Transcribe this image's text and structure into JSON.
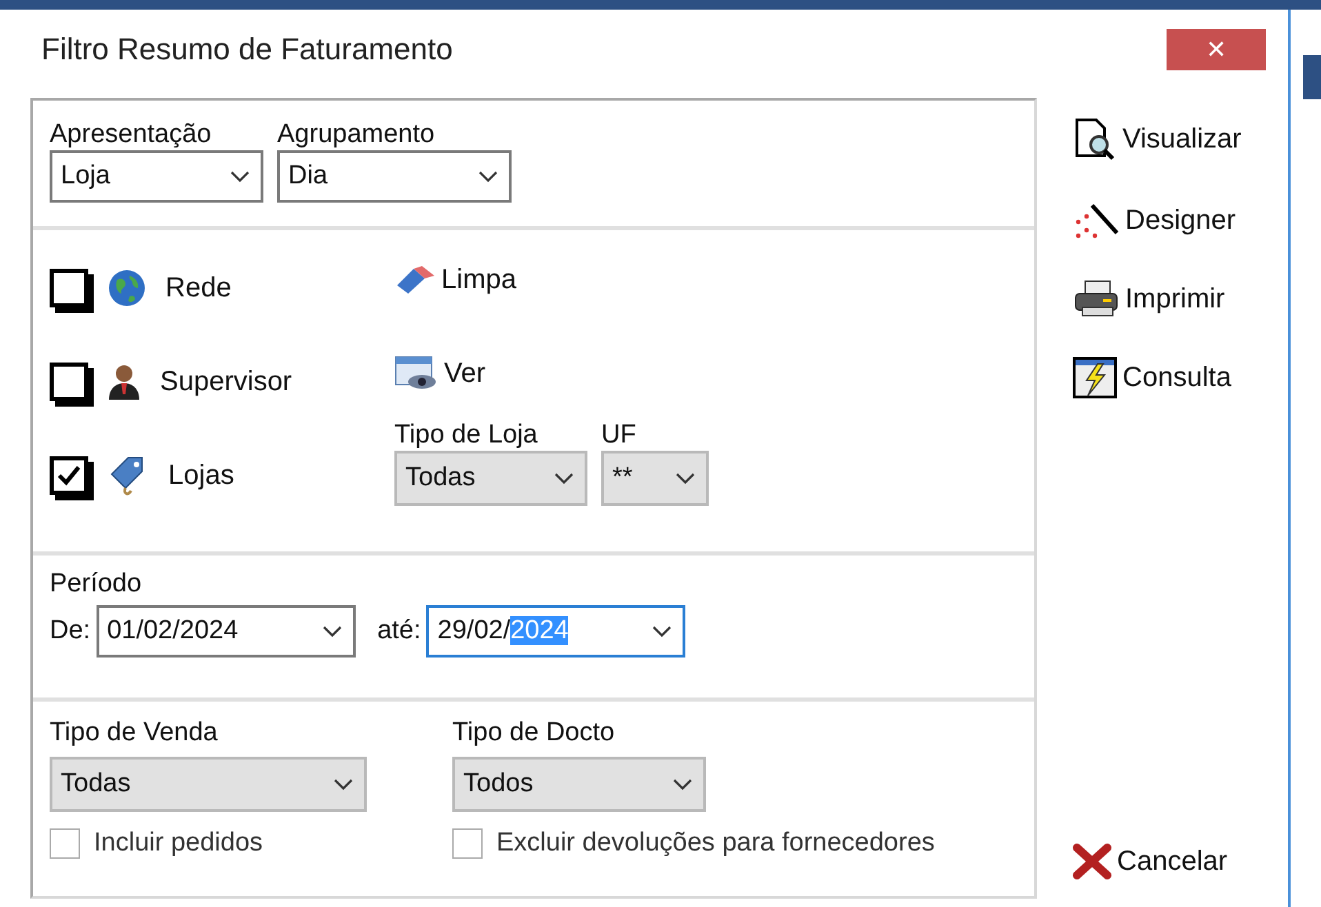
{
  "window": {
    "title": "Filtro Resumo de Faturamento",
    "close": "✕"
  },
  "grouping": [
    {
      "label": "Apresentação",
      "kind": "edit",
      "value": "Loja"
    },
    {
      "label": "Agrupamento",
      "kind": "edit",
      "value": "Dia"
    }
  ],
  "filters": [
    {
      "label": "Rede",
      "checked": false
    },
    {
      "label": "Supervisor",
      "checked": false
    },
    {
      "label": "Lojas",
      "checked": true
    }
  ],
  "filter_tools": [
    {
      "label": "Limpa"
    },
    {
      "label": "Ver"
    }
  ],
  "store_selects": [
    {
      "label": "Tipo de Loja",
      "kind": "list",
      "value": "Todas"
    },
    {
      "label": "UF",
      "kind": "list",
      "value": "**"
    }
  ],
  "period": {
    "title": "Período",
    "from": {
      "label": "De:",
      "text": "01/02/2024",
      "focused": false
    },
    "to": {
      "label": "até:",
      "text": "29/02/",
      "highlighted_text": "2024",
      "focused": true
    }
  },
  "sale_selects": [
    {
      "label": "Tipo de Venda",
      "kind": "list",
      "value": "Todas",
      "option": {
        "label": "Incluir pedidos",
        "checked": false
      }
    },
    {
      "label": "Tipo de Docto",
      "kind": "list",
      "value": "Todos",
      "option": {
        "label": "Excluir devoluções para fornecedores",
        "checked": false
      }
    }
  ],
  "actions": [
    {
      "label": "Visualizar"
    },
    {
      "label": "Designer"
    },
    {
      "label": "Imprimir"
    },
    {
      "label": "Consulta"
    }
  ],
  "cancel": {
    "label": "Cancelar"
  }
}
